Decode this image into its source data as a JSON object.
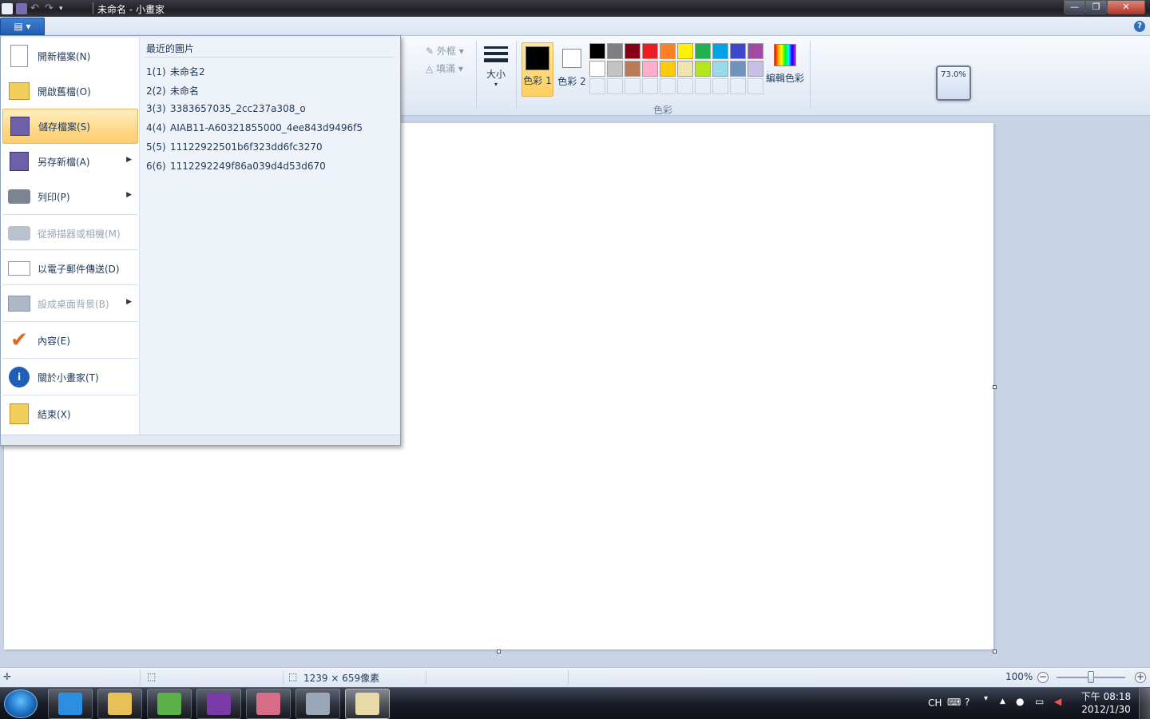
{
  "window": {
    "title": "未命名 - 小畫家"
  },
  "titlebar": {
    "minimize_label": "—",
    "maximize_label": "❐",
    "close_label": "✕"
  },
  "ribbon": {
    "help_label": "?",
    "outline_label": "外框",
    "fill_label": "填滿",
    "size_label": "大小",
    "color1_label": "色彩 1",
    "color2_label": "色彩 2",
    "edit_colors_label": "編輯色彩",
    "colors_group_label": "色彩",
    "color1_value": "#000000",
    "color2_value": "#ffffff",
    "palette_row1": [
      "#000000",
      "#7f7f7f",
      "#880015",
      "#ed1c24",
      "#ff7f27",
      "#fff200",
      "#22b14c",
      "#00a2e8",
      "#3f48cc",
      "#a349a4"
    ],
    "palette_row2": [
      "#ffffff",
      "#c3c3c3",
      "#b97a57",
      "#ffaec9",
      "#ffc90e",
      "#efe4b0",
      "#b5e61d",
      "#99d9ea",
      "#7092be",
      "#c8bfe7"
    ],
    "zoom_popup": "73.0%"
  },
  "app_menu": {
    "button_icon": "app-menu-icon",
    "items": [
      {
        "label": "開新檔案(N)",
        "icon": "new-file-icon",
        "enabled": true
      },
      {
        "label": "開啟舊檔(O)",
        "icon": "open-folder-icon",
        "enabled": true
      },
      {
        "label": "儲存檔案(S)",
        "icon": "save-disk-icon",
        "enabled": true,
        "selected": true
      },
      {
        "label": "另存新檔(A)",
        "icon": "save-as-icon",
        "enabled": true,
        "submenu": true
      },
      {
        "label": "列印(P)",
        "icon": "printer-icon",
        "enabled": true,
        "submenu": true
      },
      {
        "label": "從掃描器或相機(M)",
        "icon": "scanner-icon",
        "enabled": false
      },
      {
        "label": "以電子郵件傳送(D)",
        "icon": "email-icon",
        "enabled": true
      },
      {
        "label": "設成桌面背景(B)",
        "icon": "desktop-background-icon",
        "enabled": false,
        "submenu": true
      },
      {
        "label": "內容(E)",
        "icon": "checkmark-icon",
        "enabled": true
      },
      {
        "label": "關於小畫家(T)",
        "icon": "info-icon",
        "enabled": true
      },
      {
        "label": "結束(X)",
        "icon": "exit-icon",
        "enabled": true
      }
    ],
    "recent_title": "最近的圖片",
    "recent": [
      {
        "num": "1(1)",
        "name": "未命名2"
      },
      {
        "num": "2(2)",
        "name": "未命名"
      },
      {
        "num": "3(3)",
        "name": "3383657035_2cc237a308_o"
      },
      {
        "num": "4(4)",
        "name": "AIAB11-A60321855000_4ee843d9496f5"
      },
      {
        "num": "5(5)",
        "name": "11122922501b6f323dd6fc3270"
      },
      {
        "num": "6(6)",
        "name": "1112292249f86a039d4d53d670"
      }
    ]
  },
  "statusbar": {
    "dimensions": "1239 × 659像素",
    "zoom": "100%",
    "zoom_minus": "−",
    "zoom_plus": "+"
  },
  "taskbar": {
    "apps": [
      "ie-icon",
      "file-explorer-icon",
      "messenger-icon",
      "yahoo-messenger-icon",
      "game-icon",
      "calculator-icon",
      "paint-icon"
    ],
    "lang": "CH",
    "time": "下午 08:18",
    "date": "2012/1/30"
  }
}
